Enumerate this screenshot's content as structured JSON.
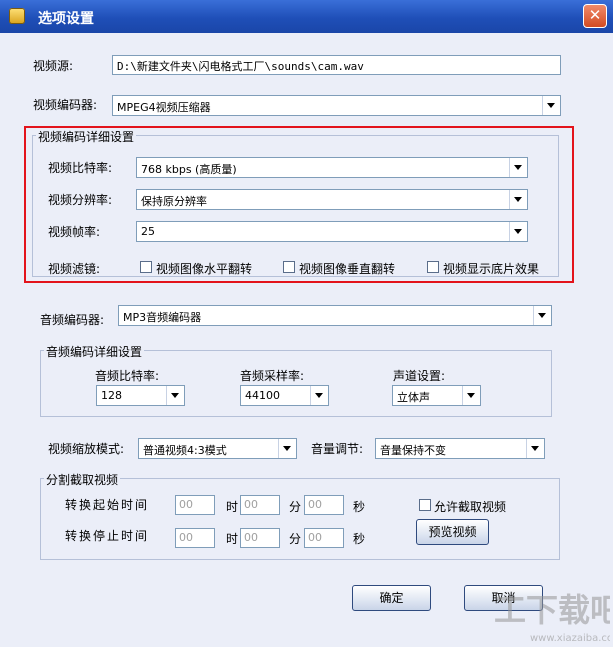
{
  "window": {
    "title": "选项设置",
    "close_symbol": "✕"
  },
  "video": {
    "source_label": "视频源:",
    "source_value": "D:\\新建文件夹\\闪电格式工厂\\sounds\\cam.wav",
    "encoder_label": "视频编码器:",
    "encoder_value": "MPEG4视频压缩器",
    "detail_group_title": "视频编码详细设置",
    "bitrate_label": "视频比特率:",
    "bitrate_value": "768 kbps (高质量)",
    "resolution_label": "视频分辨率:",
    "resolution_value": "保持原分辨率",
    "framerate_label": "视频帧率:",
    "framerate_value": "25",
    "filter_label": "视频滤镜:",
    "filters": [
      "视频图像水平翻转",
      "视频图像垂直翻转",
      "视频显示底片效果"
    ]
  },
  "audio": {
    "encoder_label": "音频编码器:",
    "encoder_value": "MP3音频编码器",
    "detail_group_title": "音频编码详细设置",
    "bitrate_label": "音频比特率:",
    "bitrate_value": "128",
    "samplerate_label": "音频采样率:",
    "samplerate_value": "44100",
    "channel_label": "声道设置:",
    "channel_value": "立体声"
  },
  "scaling": {
    "mode_label": "视频缩放模式:",
    "mode_value": "普通视频4:3模式",
    "volume_label": "音量调节:",
    "volume_value": "音量保持不变"
  },
  "split": {
    "group_title": "分割截取视频",
    "start_label": "转换起始时间",
    "end_label": "转换停止时间",
    "hour_unit": "时",
    "minute_unit": "分",
    "second_unit": "秒",
    "placeholder": "00",
    "allow_label": "允许截取视频",
    "preview_button": "预览视频"
  },
  "buttons": {
    "ok": "确定",
    "cancel": "取消"
  },
  "watermark": {
    "text": "工下载吧",
    "url": "www.xiazaiba.com"
  }
}
